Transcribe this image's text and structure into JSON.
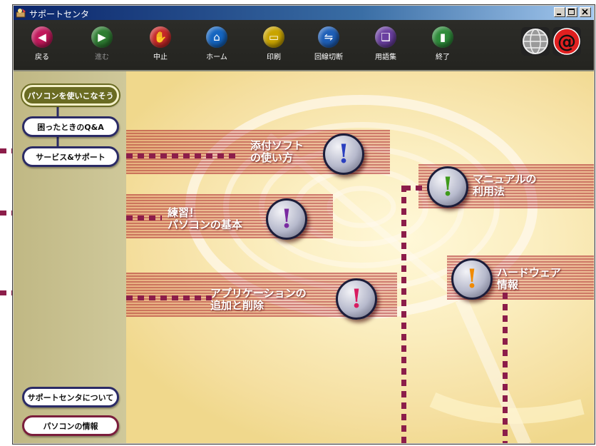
{
  "window": {
    "title": "サポートセンタ"
  },
  "toolbar": {
    "buttons": [
      {
        "label": "戻る",
        "icon": "back-arrow-icon",
        "color": "#c1185b",
        "glyph": "◀",
        "enabled": true
      },
      {
        "label": "進む",
        "icon": "forward-arrow-icon",
        "color": "#2e7d32",
        "glyph": "▶",
        "enabled": false
      },
      {
        "label": "中止",
        "icon": "stop-hand-icon",
        "color": "#c62828",
        "glyph": "✋",
        "enabled": true
      },
      {
        "label": "ホーム",
        "icon": "home-icon",
        "color": "#1565c0",
        "glyph": "⌂",
        "enabled": true
      },
      {
        "label": "印刷",
        "icon": "printer-icon",
        "color": "#c9a400",
        "glyph": "▭",
        "enabled": true
      },
      {
        "label": "回線切断",
        "icon": "disconnect-icon",
        "color": "#1e5fb8",
        "glyph": "⇋",
        "enabled": true
      },
      {
        "label": "用語集",
        "icon": "glossary-book-icon",
        "color": "#6a3fa0",
        "glyph": "❑",
        "enabled": true
      },
      {
        "label": "終了",
        "icon": "exit-door-icon",
        "color": "#2e8b3a",
        "glyph": "▮",
        "enabled": true
      }
    ],
    "globe_icon": "globe-icon",
    "at_icon": "at-sign-icon",
    "at_glyph": "@"
  },
  "sidebar": {
    "top_items": [
      {
        "label": "パソコンを使いこなそう",
        "active": true
      },
      {
        "label": "困ったときのQ&A",
        "active": false
      },
      {
        "label": "サービス&サポート",
        "active": false
      }
    ],
    "bottom_items": [
      {
        "label": "サポートセンタについて"
      },
      {
        "label": "パソコンの情報"
      }
    ]
  },
  "main": {
    "topics": [
      {
        "line1": "添付ソフト",
        "line2": "の使い方",
        "mark_color": "#2a3fbf"
      },
      {
        "line1": "練習！",
        "line2": "パソコンの基本",
        "mark_color": "#7a2aa0"
      },
      {
        "line1": "アプリケーションの",
        "line2": "追加と削除",
        "mark_color": "#d81b60"
      },
      {
        "line1": "マニュアルの",
        "line2": "利用法",
        "mark_color": "#3f9a1a"
      },
      {
        "line1": "ハードウェア",
        "line2": "情報",
        "mark_color": "#f08a00"
      }
    ],
    "mark_glyph": "!"
  },
  "colors": {
    "leader_dots": "#8c1d4a",
    "sidebar_bg": "#c8c090",
    "toolbar_bg": "#2a2a26"
  }
}
